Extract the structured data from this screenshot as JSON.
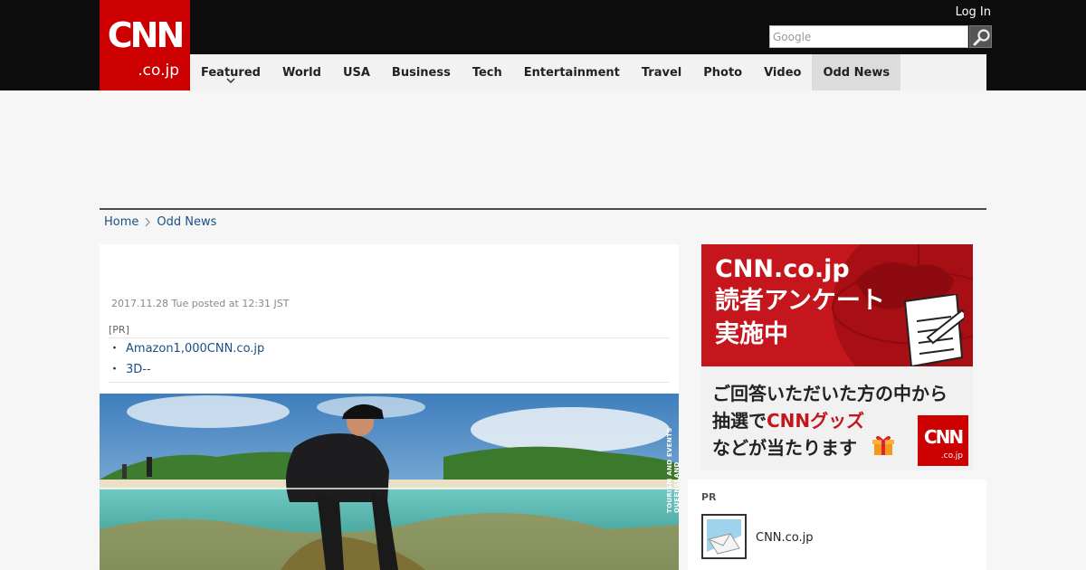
{
  "header": {
    "logo_main": "CNN",
    "logo_sub": ".co.jp",
    "login_label": "Log In",
    "search_placeholder": "Google"
  },
  "nav": {
    "items": [
      {
        "label": "Featured"
      },
      {
        "label": "World"
      },
      {
        "label": "USA"
      },
      {
        "label": "Business"
      },
      {
        "label": "Tech"
      },
      {
        "label": "Entertainment"
      },
      {
        "label": "Travel"
      },
      {
        "label": "Photo"
      },
      {
        "label": "Video"
      },
      {
        "label": "Odd News"
      }
    ],
    "active": "Odd News"
  },
  "breadcrumb": {
    "home": "Home",
    "current": "Odd News"
  },
  "article": {
    "date": "2017.11.28 Tue posted at 12:31 JST",
    "pr_label": "[PR]",
    "pr_links": [
      "Amazon1,000CNN.co.jp",
      "3D--"
    ],
    "photo_credit": "TOURISM AND EVENTS QUEENSLAND"
  },
  "banner": {
    "line1": "CNN.co.jp",
    "line2": "読者アンケート",
    "line3": "実施中",
    "sub1": "ご回答いただいた方の中から",
    "sub2_pre": "抽選で",
    "sub2_red": "CNNグッズ",
    "sub3": "などが当たります",
    "logo_main": "CNN",
    "logo_sub": ".co.jp",
    "accent": "#c4161c"
  },
  "side_pr": {
    "label": "PR",
    "text": "CNN.co.jp"
  },
  "colors": {
    "brand_red": "#cc0000",
    "link_blue": "#1a4f86",
    "topbar": "#0c0c0c"
  }
}
